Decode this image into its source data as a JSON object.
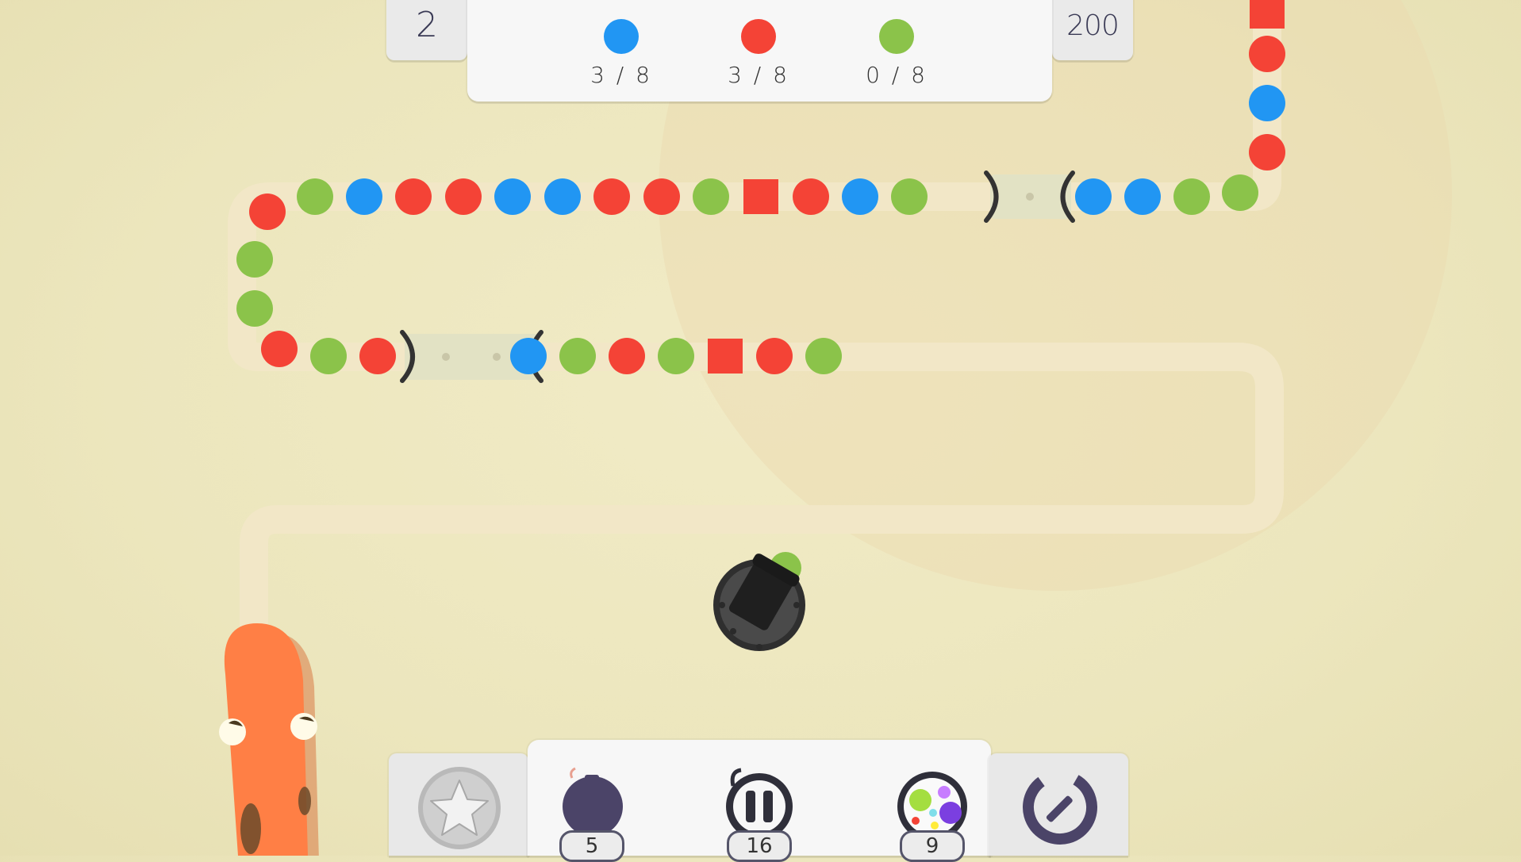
{
  "hud": {
    "level": "2",
    "score": "200"
  },
  "goals": [
    {
      "color_name": "blue",
      "color": "#2196f3",
      "progress": "3 / 8"
    },
    {
      "color_name": "red",
      "color": "#f44336",
      "progress": "3 / 8"
    },
    {
      "color_name": "green",
      "color": "#8bc34a",
      "progress": "0 / 8"
    }
  ],
  "powerups": [
    {
      "name": "bomb",
      "icon": "bomb-icon",
      "count": "5"
    },
    {
      "name": "pause",
      "icon": "pause-icon",
      "count": "16"
    },
    {
      "name": "color-ball",
      "icon": "multicolor-ball-icon",
      "count": "9"
    }
  ],
  "buttons": {
    "favorite_icon": "star-icon",
    "restart_icon": "restart-icon"
  },
  "palette": {
    "blue": "#2196f3",
    "red": "#f44336",
    "green": "#8bc34a",
    "track": "#f3e9cc",
    "worm": "#ff7f45",
    "cannon": "#333333"
  },
  "chain_upper": [
    "red-square",
    "red",
    "blue",
    "red",
    "green",
    "green",
    "blue",
    "blue",
    "green",
    "blue",
    "red",
    "red-square",
    "green",
    "red",
    "red",
    "blue",
    "blue",
    "red",
    "red",
    "blue",
    "green",
    "red",
    "green",
    "green"
  ],
  "chain_lower": [
    "red",
    "green",
    "red",
    "blue",
    "green",
    "red",
    "green",
    "red-square",
    "red",
    "green"
  ],
  "cannon_ball": "green"
}
